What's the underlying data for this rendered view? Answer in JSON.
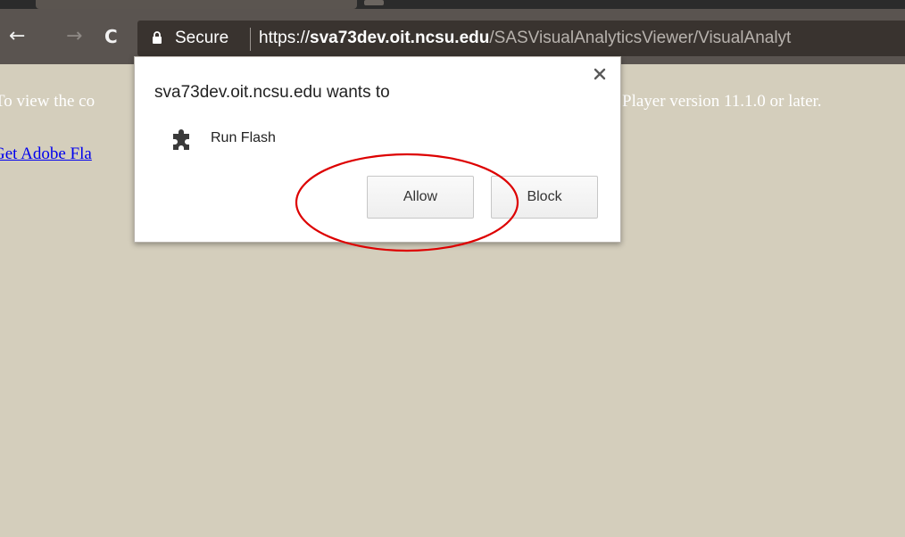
{
  "toolbar": {
    "back_icon": "←",
    "forward_icon": "→",
    "reload_icon": "C"
  },
  "omnibox": {
    "secure_label": "Secure",
    "url_scheme": "https://",
    "url_host": "sva73dev.oit.ncsu.edu",
    "url_path": "/SASVisualAnalyticsViewer/VisualAnalyt"
  },
  "page": {
    "flash_message_left": "To view the co",
    "flash_message_right": "Player version 11.1.0 or later.",
    "flash_link": "Get Adobe Fla"
  },
  "popup": {
    "title": "sva73dev.oit.ncsu.edu wants to",
    "item_label": "Run Flash",
    "allow_label": "Allow",
    "block_label": "Block",
    "close_icon": "close-icon"
  },
  "colors": {
    "toolbar_bg": "#5a5450",
    "content_bg": "#d4cebc",
    "annotation": "#dd0000",
    "link": "#0000ee"
  }
}
